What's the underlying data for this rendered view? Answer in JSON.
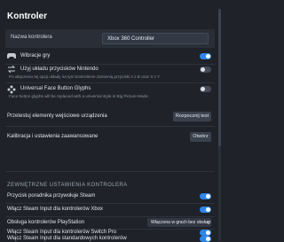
{
  "header": {
    "title": "Kontroler"
  },
  "controller_name": {
    "label": "Nazwa kontrolera",
    "value": "Xbox 360 Controller"
  },
  "rumble": {
    "icon": "gamepad-icon",
    "label": "Wibracje gry",
    "enabled": true
  },
  "nintendo_layout": {
    "icon": "swap-icon",
    "label": "Użyj układu przycisków Nintendo",
    "description": "Po włączeniu tej opcji układy na tym kontrolerze zamienią przyciski A z B oraz X z Y",
    "enabled": false
  },
  "universal_glyphs": {
    "icon": "glyph-icon",
    "label": "Universal Face Button Glyphs",
    "description": "Face button glyphs will be replaced with a universal style in Big Picture Mode.",
    "enabled": false
  },
  "test_inputs": {
    "label": "Przetestuj elementy wejściowe urządzenia",
    "button": "Rozpocznij test"
  },
  "calibration": {
    "label": "Kalibracja i ustawienia zaawansowane",
    "button": "Otwórz"
  },
  "external_section": {
    "title": "ZEWNĘTRZNE USTAWIENIA KONTROLERA"
  },
  "steam_guide": {
    "label": "Przycisk poradnika przywołuje Steam",
    "enabled": true
  },
  "steam_input_xbox": {
    "label": "Włącz Steam Input dla kontrolerów Xbox",
    "enabled": true
  },
  "playstation": {
    "label": "Obsługa kontrolerów PlayStation",
    "value": "Włączona w grach bez obsługi"
  },
  "switch_pro": {
    "label": "Włącz Steam Input dla kontrolerów Switch Pro",
    "enabled": true
  },
  "generic": {
    "label": "Włącz Steam Input dla standardowych kontrolerów",
    "enabled": true
  },
  "colors": {
    "accent": "#2f86e8",
    "background": "#1f2329",
    "row": "#2a2f37"
  }
}
